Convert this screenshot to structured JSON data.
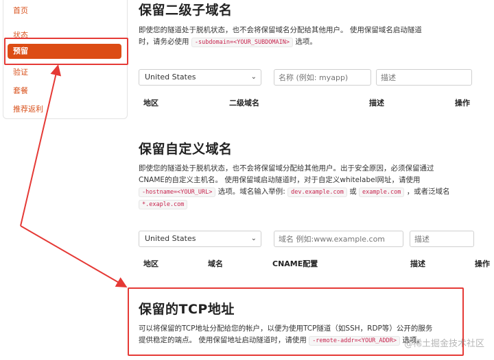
{
  "sidebar": {
    "items": [
      {
        "label": "首页"
      },
      {
        "label": "状态"
      },
      {
        "label": "预留"
      },
      {
        "label": "验证"
      },
      {
        "label": "套餐"
      },
      {
        "label": "推荐返利"
      }
    ]
  },
  "subdomain": {
    "title": "保留二级子域名",
    "desc_part1": "即使您的隧道处于脱机状态，也不会将保留域名分配给其他用户。 使用保留域名启动隧道",
    "desc_part2": "时，请务必使用",
    "code": "-subdomain=<YOUR_SUBDOMAIN>",
    "desc_part3": "选项。",
    "region_value": "United States",
    "name_placeholder": "名称 (例如: myapp)",
    "desc_placeholder": "描述",
    "columns": [
      "地区",
      "二级域名",
      "描述",
      "操作"
    ]
  },
  "custom_domain": {
    "title": "保留自定义域名",
    "line1": "即使您的隧道处于脱机状态，也不会将保留域分配给其他用户。出于安全原因，必须保留通过",
    "line2": "CNAME的自定义主机名。 使用保留域启动隧道时，对于自定义whitelabel网址，请使用",
    "code_hostname": "-hostname=<YOUR_URL>",
    "line3a": "选项。域名输入举例:",
    "code_example1": "dev.example.com",
    "line3b": "或",
    "code_example2": "example.com",
    "line3c": "，或者泛域名",
    "code_wildcard": "*.exaple.com",
    "region_value": "United States",
    "domain_placeholder": "域名 例如:www.example.com",
    "desc_placeholder": "描述",
    "columns": [
      "地区",
      "域名",
      "CNAME配置",
      "描述",
      "操作"
    ]
  },
  "tcp": {
    "title": "保留的TCP地址",
    "line1": "可以将保留的TCP地址分配给您的帐户，以便为使用TCP隧道（如SSH，RDP等）公开的服务",
    "line2a": "提供稳定的端点。 使用保留地址启动隧道时，请使用",
    "code": "-remote-addr=<YOUR_ADDR>",
    "line2b": "选项。"
  },
  "watermark": "@稀土掘金技术社区",
  "colors": {
    "accent": "#dc4c14",
    "highlight": "#e53935",
    "code": "#c7254e"
  }
}
